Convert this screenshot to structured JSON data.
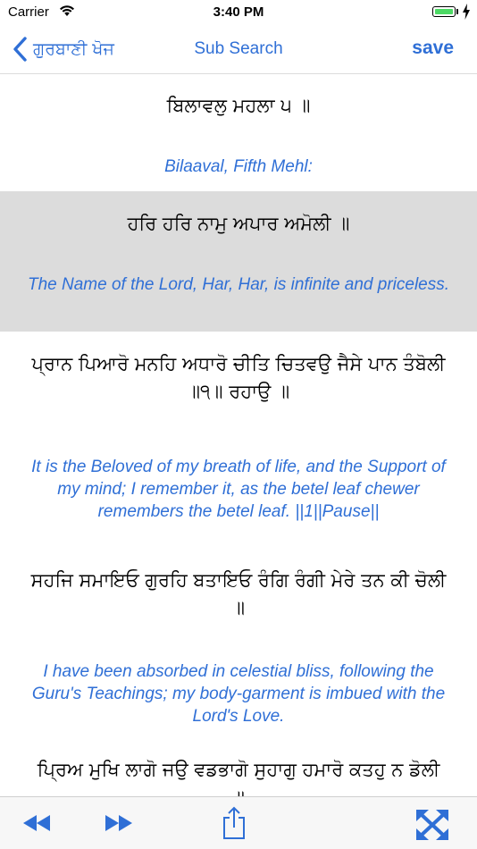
{
  "status_bar": {
    "carrier": "Carrier",
    "time": "3:40 PM",
    "battery_level": 0.85,
    "icons": [
      "wifi-icon",
      "battery-icon",
      "charging-bolt-icon"
    ]
  },
  "nav": {
    "back_label": "ਗੁਰਬਾਣੀ ਖੋਜ",
    "title": "Sub Search",
    "save_label": "save",
    "icons": [
      "chevron-left-icon"
    ]
  },
  "colors": {
    "accent": "#2f6fd6",
    "selected_row": "#dcdcdc",
    "toolbar_bg": "#f7f7f7"
  },
  "verses": [
    {
      "gurmukhi": "ਬਿਲਾਵਲੁ ਮਹਲਾ ੫ ॥",
      "translation": "Bilaaval, Fifth Mehl:",
      "selected": false
    },
    {
      "gurmukhi": "ਹਰਿ ਹਰਿ ਨਾਮੁ ਅਪਾਰ ਅਮੋਲੀ ॥",
      "translation": "The Name of the Lord, Har, Har, is infinite and priceless.",
      "selected": true
    },
    {
      "gurmukhi": "ਪ੍ਰਾਨ ਪਿਆਰੋ ਮਨਹਿ ਅਧਾਰੋ ਚੀਤਿ ਚਿਤਵਉ ਜੈਸੇ ਪਾਨ ਤੰਬੋਲੀ ॥੧॥ ਰਹਾਉ ॥",
      "translation": "It is the Beloved of my breath of life, and the Support of my mind; I remember it, as the betel leaf chewer remembers the betel leaf. ||1||Pause||",
      "selected": false
    },
    {
      "gurmukhi": "ਸਹਜਿ ਸਮਾਇਓ ਗੁਰਹਿ ਬਤਾਇਓ ਰੰਗਿ ਰੰਗੀ ਮੇਰੇ ਤਨ ਕੀ ਚੋਲੀ ॥",
      "translation": "I have been absorbed in celestial bliss, following the Guru's Teachings; my body-garment is imbued with the Lord's Love.",
      "selected": false
    },
    {
      "gurmukhi": "ਪ੍ਰਿਅ ਮੁਖਿ ਲਾਗੋ ਜਉ ਵਡਭਾਗੋ ਸੁਹਾਗੁ ਹਮਾਰੋ ਕਤਹੁ ਨ ਡੋਲੀ ॥",
      "translation": "",
      "selected": false
    }
  ],
  "toolbar": {
    "icons": [
      "rewind-icon",
      "fast-forward-icon",
      "share-icon",
      "expand-icon"
    ]
  }
}
